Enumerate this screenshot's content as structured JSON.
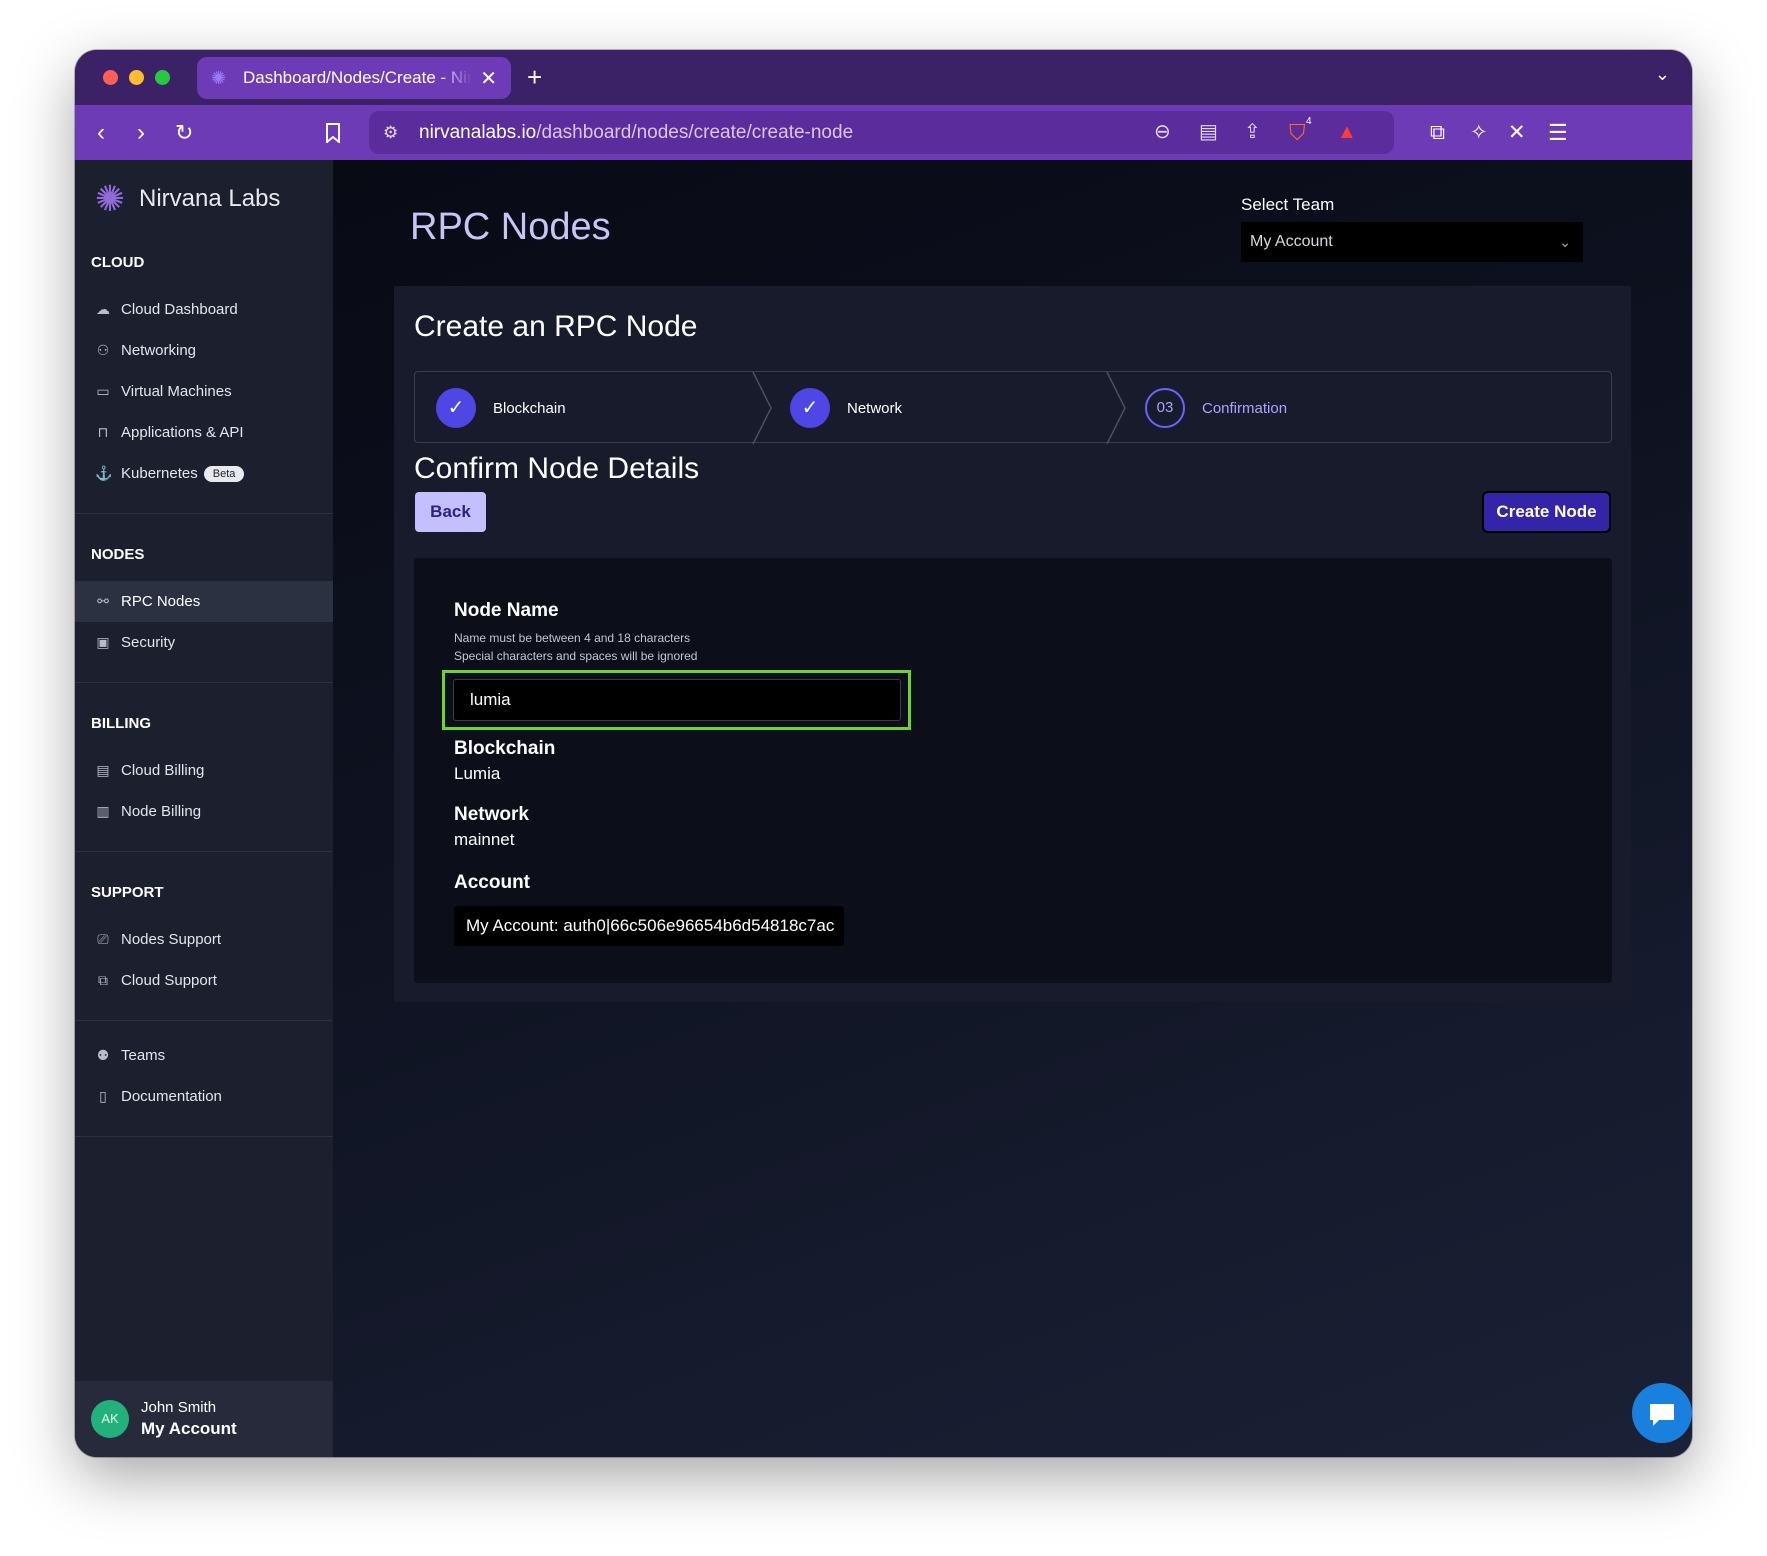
{
  "browser": {
    "tab_title": "Dashboard/Nodes/Create - Nirvana Labs",
    "url_host": "nirvanalabs.io",
    "url_path": "/dashboard/nodes/create/create-node",
    "shield_badge_count": "4"
  },
  "sidebar": {
    "brand": "Nirvana Labs",
    "cloud": {
      "heading": "CLOUD",
      "items": [
        {
          "label": "Cloud Dashboard",
          "icon": "cloud-icon"
        },
        {
          "label": "Networking",
          "icon": "network-icon"
        },
        {
          "label": "Virtual Machines",
          "icon": "monitor-icon"
        },
        {
          "label": "Applications & API",
          "icon": "lock-icon"
        },
        {
          "label": "Kubernetes",
          "icon": "anchor-icon",
          "badge": "Beta"
        }
      ]
    },
    "nodes": {
      "heading": "NODES",
      "items": [
        {
          "label": "RPC Nodes",
          "icon": "nodes-icon",
          "active": true
        },
        {
          "label": "Security",
          "icon": "toolbox-icon"
        }
      ]
    },
    "billing": {
      "heading": "BILLING",
      "items": [
        {
          "label": "Cloud Billing",
          "icon": "receipt-icon"
        },
        {
          "label": "Node Billing",
          "icon": "list-icon"
        }
      ]
    },
    "support": {
      "heading": "SUPPORT",
      "items": [
        {
          "label": "Nodes Support",
          "icon": "chat-alert-icon"
        },
        {
          "label": "Cloud Support",
          "icon": "copy-icon"
        }
      ]
    },
    "other": {
      "items": [
        {
          "label": "Teams",
          "icon": "users-icon"
        },
        {
          "label": "Documentation",
          "icon": "book-icon"
        }
      ]
    },
    "profile": {
      "initials": "AK",
      "name": "John Smith",
      "account": "My Account"
    }
  },
  "main": {
    "page_title": "RPC Nodes",
    "team_label": "Select Team",
    "team_value": "My Account",
    "card_title": "Create an RPC Node",
    "steps": [
      {
        "label": "Blockchain",
        "state": "done"
      },
      {
        "label": "Network",
        "state": "done"
      },
      {
        "label": "Confirmation",
        "number": "03",
        "state": "current"
      }
    ],
    "confirm_title": "Confirm Node Details",
    "back_label": "Back",
    "create_label": "Create Node",
    "fields": {
      "node_name_label": "Node Name",
      "node_name_hint1": "Name must be between 4 and 18 characters",
      "node_name_hint2": "Special characters and spaces will be ignored",
      "node_name_value": "lumia",
      "blockchain_label": "Blockchain",
      "blockchain_value": "Lumia",
      "network_label": "Network",
      "network_value": "mainnet",
      "account_label": "Account",
      "account_value": "My Account: auth0|66c506e96654b6d54818c7ac"
    }
  },
  "colors": {
    "accent": "#5046e5",
    "highlight_border": "#6fd42a",
    "chrome": "#6e3bb7"
  }
}
